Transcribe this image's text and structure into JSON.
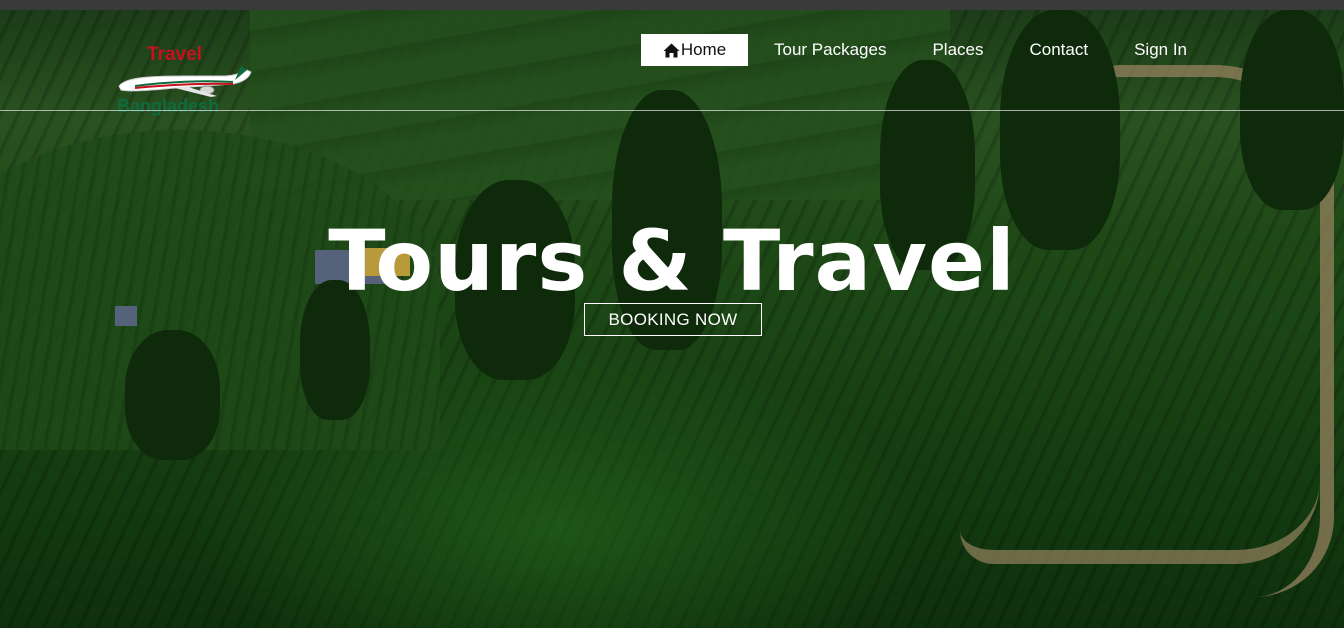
{
  "logo": {
    "top_text": "Travel",
    "bottom_text": "Bangladesh",
    "icon": "airplane-icon"
  },
  "nav": {
    "items": [
      {
        "label": "Home",
        "icon": "home-icon",
        "active": true
      },
      {
        "label": "Tour Packages"
      },
      {
        "label": "Places"
      },
      {
        "label": "Contact"
      },
      {
        "label": "Sign In"
      }
    ]
  },
  "hero": {
    "title": "Tours & Travel",
    "button_label": "BOOKING NOW"
  },
  "colors": {
    "accent_red": "#c8101e",
    "accent_green": "#0f6b3e",
    "active_bg": "#ffffff",
    "text": "#ffffff"
  }
}
